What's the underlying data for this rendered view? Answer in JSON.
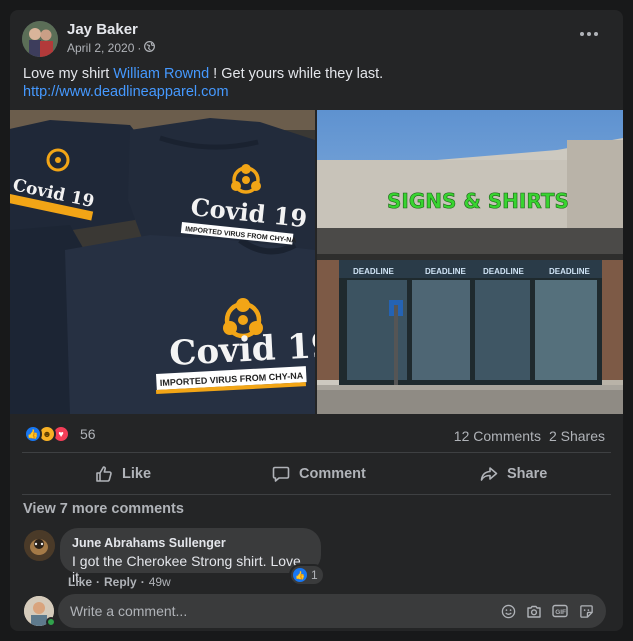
{
  "post": {
    "author": "Jay Baker",
    "date": "April 2, 2020",
    "date_separator": "·",
    "text_before": "Love my shirt ",
    "tagged_user": "William Rownd",
    "text_after": " ! Get yours while they last.",
    "link": "http://www.deadlineapparel.com"
  },
  "photos": {
    "left": {
      "shirt_title": "Covid 19",
      "shirt_banner": "IMPORTED VIRUS FROM CHY-NA"
    },
    "right": {
      "store_sign": "SIGNS & SHIRTS",
      "window_logo": "DEADLINE"
    }
  },
  "reactions": {
    "count": "56",
    "comments": "12 Comments",
    "shares": "2 Shares"
  },
  "actions": {
    "like": "Like",
    "comment": "Comment",
    "share": "Share"
  },
  "comments": {
    "view_more": "View 7 more comments",
    "items": [
      {
        "name": "June Abrahams Sullenger",
        "text": "I got the Cherokee Strong shirt. Love it",
        "like_label": "Like",
        "reply_label": "Reply",
        "time": "49w",
        "like_count": "1"
      }
    ],
    "write_placeholder": "Write a comment..."
  },
  "icons": [
    "globe-icon",
    "more-icon",
    "like-icon",
    "comment-icon",
    "share-icon",
    "emoji-icon",
    "camera-icon",
    "gif-icon",
    "sticker-icon"
  ],
  "colors": {
    "background": "#18191a",
    "card": "#242526",
    "link": "#4599ff",
    "like_blue": "#1877f2",
    "sign_green": "#38d430"
  }
}
